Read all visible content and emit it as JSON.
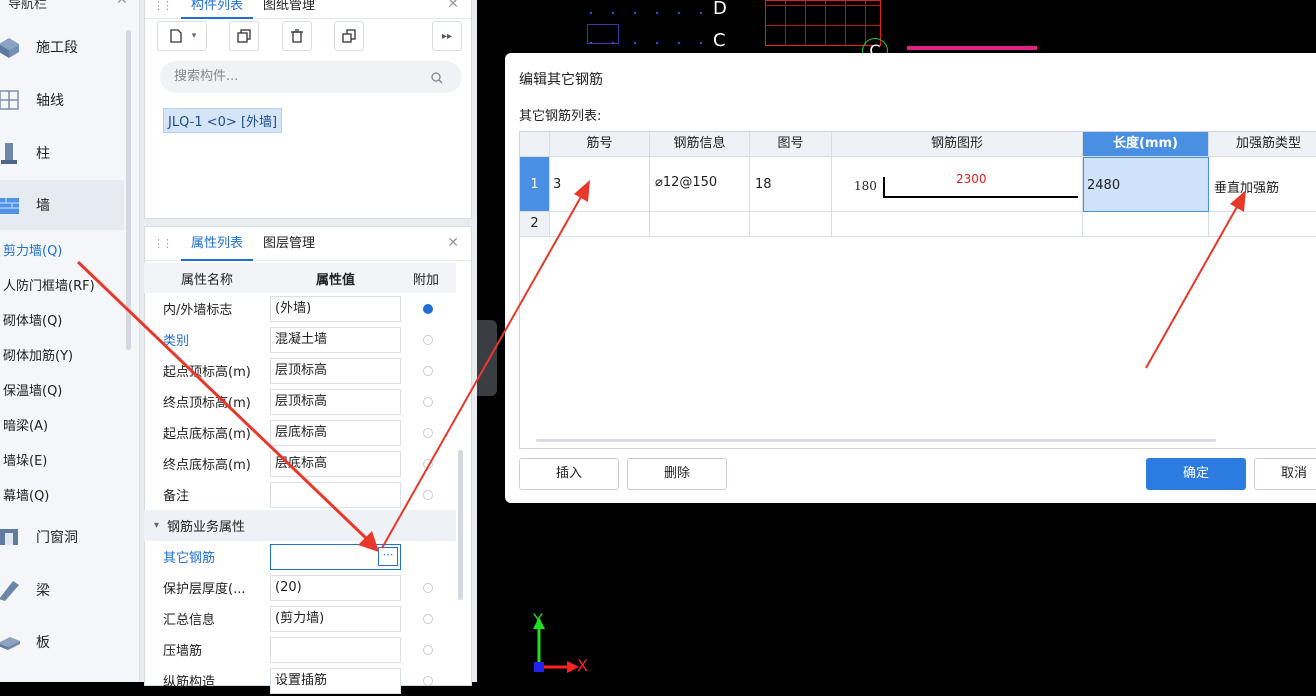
{
  "nav": {
    "title": "导航栏",
    "categories": [
      {
        "label": "施工段",
        "icon": "segment-icon"
      },
      {
        "label": "轴线",
        "icon": "grid-axis-icon"
      },
      {
        "label": "柱",
        "icon": "column-icon"
      },
      {
        "label": "墙",
        "icon": "wall-icon"
      },
      {
        "label": "门窗洞",
        "icon": "door-window-icon"
      },
      {
        "label": "梁",
        "icon": "beam-icon"
      },
      {
        "label": "板",
        "icon": "slab-icon"
      }
    ],
    "wall_items": [
      "剪力墙(Q)",
      "人防门框墙(RF)",
      "砌体墙(Q)",
      "砌体加筋(Y)",
      "保温墙(Q)",
      "暗梁(A)",
      "墙垛(E)",
      "幕墙(Q)"
    ]
  },
  "component_panel": {
    "tabs": [
      "构件列表",
      "图纸管理"
    ],
    "search_placeholder": "搜索构件...",
    "selected_item": "JLQ-1 <0> [外墙]"
  },
  "property_panel": {
    "tabs": [
      "属性列表",
      "图层管理"
    ],
    "headers": [
      "属性名称",
      "属性值",
      "附加"
    ],
    "rows": [
      {
        "name": "内/外墙标志",
        "value": "(外墙)",
        "extra": true
      },
      {
        "name": "类别",
        "value": "混凝土墙",
        "extra": false,
        "blue": true
      },
      {
        "name": "起点顶标高(m)",
        "value": "层顶标高",
        "extra": false
      },
      {
        "name": "终点顶标高(m)",
        "value": "层顶标高",
        "extra": false
      },
      {
        "name": "起点底标高(m)",
        "value": "层底标高",
        "extra": false
      },
      {
        "name": "终点底标高(m)",
        "value": "层底标高",
        "extra": false
      },
      {
        "name": "备注",
        "value": "",
        "extra": false
      }
    ],
    "group_title": "钢筋业务属性",
    "rows2": [
      {
        "name": "其它钢筋",
        "value": "",
        "blue": true,
        "ellipsis": true
      },
      {
        "name": "保护层厚度(...",
        "value": "(20)",
        "extra": false
      },
      {
        "name": "汇总信息",
        "value": "(剪力墙)",
        "extra": false
      },
      {
        "name": "压墙筋",
        "value": "",
        "extra": false
      },
      {
        "name": "纵筋构造",
        "value": "设置插筋",
        "extra": false
      }
    ]
  },
  "canvas": {
    "labels": [
      "D",
      "C",
      "C"
    ],
    "axis_x": "X",
    "axis_y": "Y"
  },
  "dialog": {
    "title": "编辑其它钢筋",
    "list_label": "其它钢筋列表:",
    "columns": [
      "筋号",
      "钢筋信息",
      "图号",
      "钢筋图形",
      "长度(mm)",
      "加强筋类型"
    ],
    "rows": [
      {
        "index": "1",
        "bar_no": "3",
        "info": "⌀12@150",
        "figure_no": "18",
        "shape_left": "180",
        "shape_top": "2300",
        "length": "2480",
        "type": "垂直加强筋"
      },
      {
        "index": "2",
        "bar_no": "",
        "info": "",
        "figure_no": "",
        "shape_left": "",
        "shape_top": "",
        "length": "",
        "type": ""
      }
    ],
    "insert_label": "插入",
    "delete_label": "删除",
    "ok_label": "确定",
    "cancel_label": "取消"
  },
  "colors": {
    "accent": "#1f6fd8",
    "arrow": "#e8372b",
    "selected_cell": "#cfe2fb"
  }
}
